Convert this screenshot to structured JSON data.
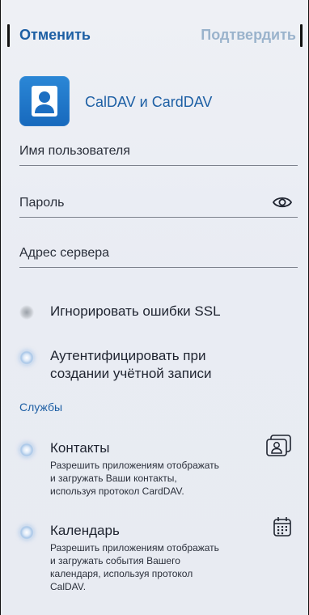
{
  "header": {
    "cancel_label": "Отменить",
    "confirm_label": "Подтвердить"
  },
  "account": {
    "title": "CalDAV и CardDAV",
    "icon": "person-card-icon"
  },
  "fields": {
    "username_placeholder": "Имя пользователя",
    "password_placeholder": "Пароль",
    "server_placeholder": "Адрес сервера"
  },
  "options": {
    "ignore_ssl_label": "Игнорировать ошибки SSL",
    "auth_label_line1": "Аутентифицировать при",
    "auth_label_line2": "создании учётной записи"
  },
  "services": {
    "header": "Службы",
    "items": [
      {
        "title": "Контакты",
        "desc_line1": "Разрешить приложениям отображать",
        "desc_line2": "и загружать Ваши контакты,",
        "desc_line3": "используя протокол CardDAV.",
        "icon": "contacts-icon"
      },
      {
        "title": "Календарь",
        "desc_line1": "Разрешить приложениям отображать",
        "desc_line2": "и загружать события Вашего",
        "desc_line3": "календаря, используя протокол",
        "desc_line4": "CalDAV.",
        "icon": "calendar-icon"
      }
    ]
  },
  "colors": {
    "accent": "#1d5fa4",
    "disabled": "#9ab3cc",
    "background": "#eceef4"
  }
}
